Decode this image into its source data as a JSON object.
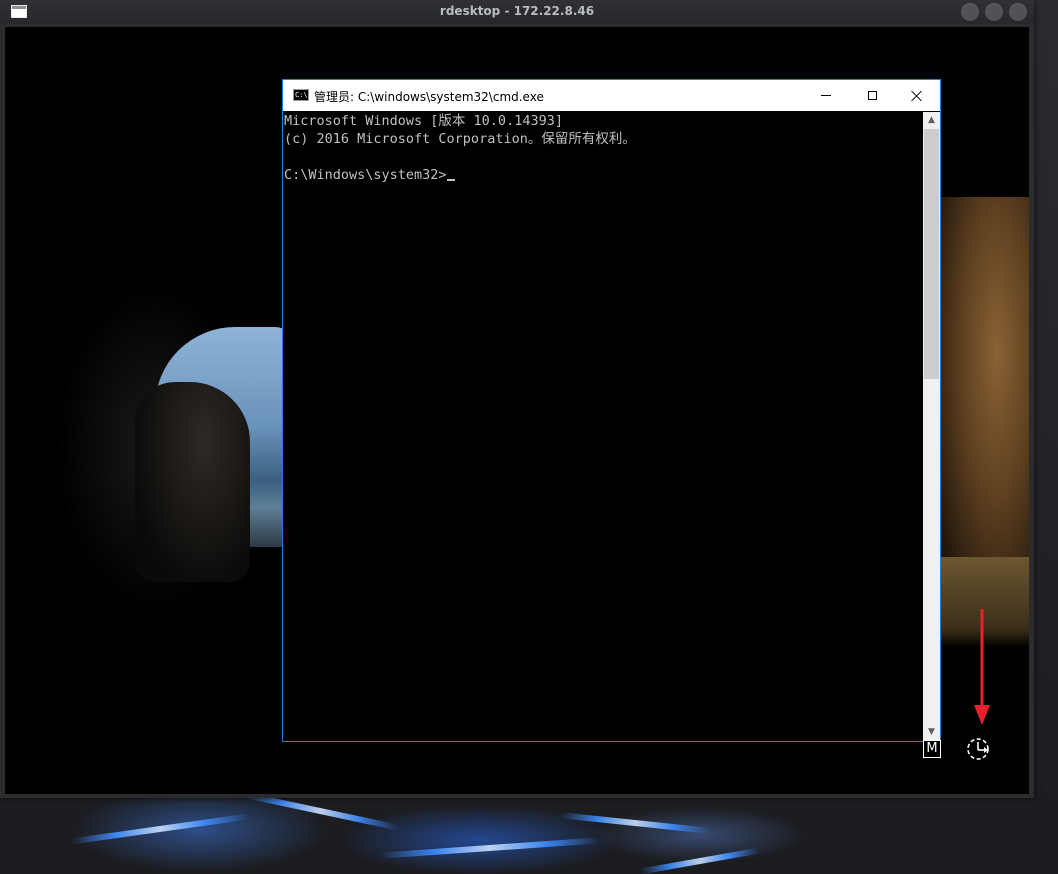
{
  "rdesktop": {
    "title": "rdesktop - 172.22.8.46"
  },
  "cmd_window": {
    "title": "管理员: C:\\windows\\system32\\cmd.exe",
    "icon_label": "C:\\",
    "console_lines": [
      "Microsoft Windows [版本 10.0.14393]",
      "(c) 2016 Microsoft Corporation。保留所有权利。",
      "",
      "C:\\Windows\\system32>"
    ]
  },
  "lock_screen": {
    "ime_indicator": "M"
  },
  "colors": {
    "cmd_border": "#2d7bd4",
    "console_text": "#c0c0c0",
    "annotation_arrow": "#e8202a"
  }
}
